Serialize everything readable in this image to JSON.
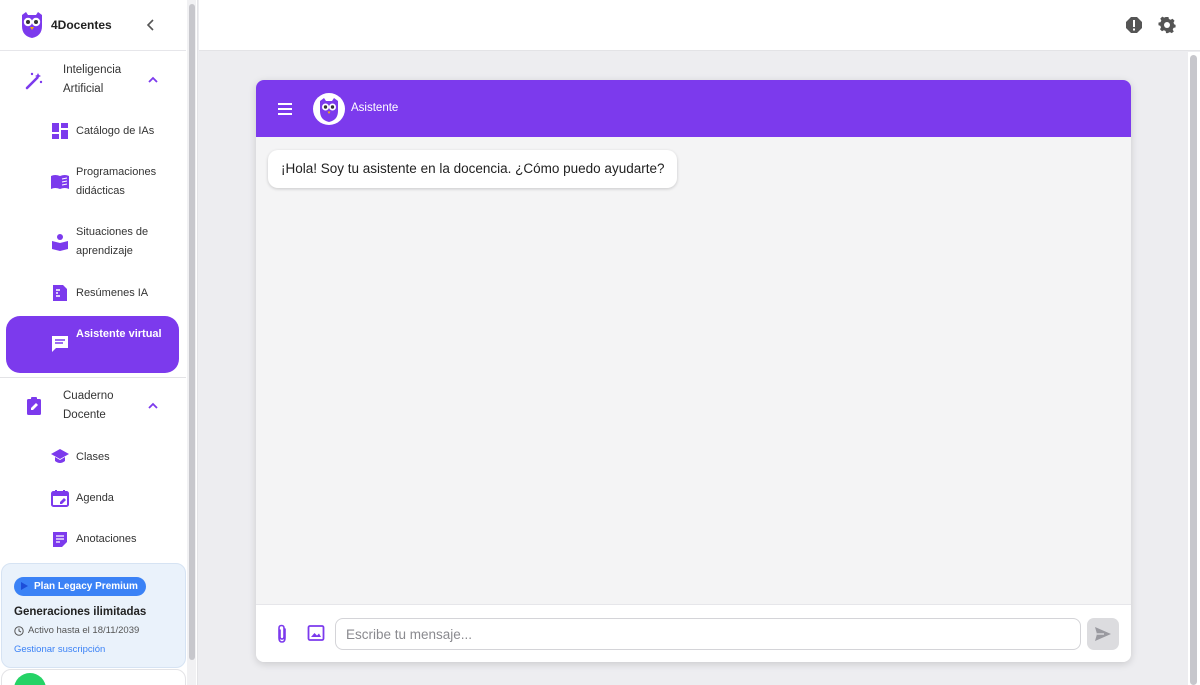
{
  "brand": {
    "name": "4Docentes"
  },
  "sidebar": {
    "groups": [
      {
        "label": "Inteligencia Artificial",
        "items": [
          {
            "label": "Catálogo de IAs"
          },
          {
            "label": "Programaciones didácticas"
          },
          {
            "label": "Situaciones de aprendizaje"
          },
          {
            "label": "Resúmenes IA"
          },
          {
            "label": "Asistente virtual",
            "active": true
          }
        ]
      },
      {
        "label": "Cuaderno Docente",
        "items": [
          {
            "label": "Clases"
          },
          {
            "label": "Agenda"
          },
          {
            "label": "Anotaciones"
          }
        ]
      }
    ],
    "plan": {
      "badge": "Plan Legacy Premium",
      "title": "Generaciones ilimitadas",
      "active_until": "Activo hasta el 18/11/2039",
      "manage_link": "Gestionar suscripción"
    }
  },
  "chat": {
    "title": "Asistente",
    "messages": [
      {
        "from": "assistant",
        "text": "¡Hola! Soy tu asistente en la docencia. ¿Cómo puedo ayudarte?"
      }
    ],
    "input_placeholder": "Escribe tu mensaje..."
  },
  "colors": {
    "accent": "#7c3aed",
    "plan_badge": "#3b82f6",
    "background": "#ededf0"
  },
  "icons": [
    "owl-logo-icon",
    "chevron-left-icon",
    "magic-wand-icon",
    "chevron-up-icon",
    "dashboard-icon",
    "book-open-icon",
    "reader-icon",
    "summary-icon",
    "chat-icon",
    "clipboard-edit-icon",
    "school-icon",
    "calendar-edit-icon",
    "notes-icon",
    "alert-icon",
    "gear-icon",
    "menu-icon",
    "paperclip-icon",
    "image-icon",
    "send-icon",
    "whatsapp-icon"
  ]
}
